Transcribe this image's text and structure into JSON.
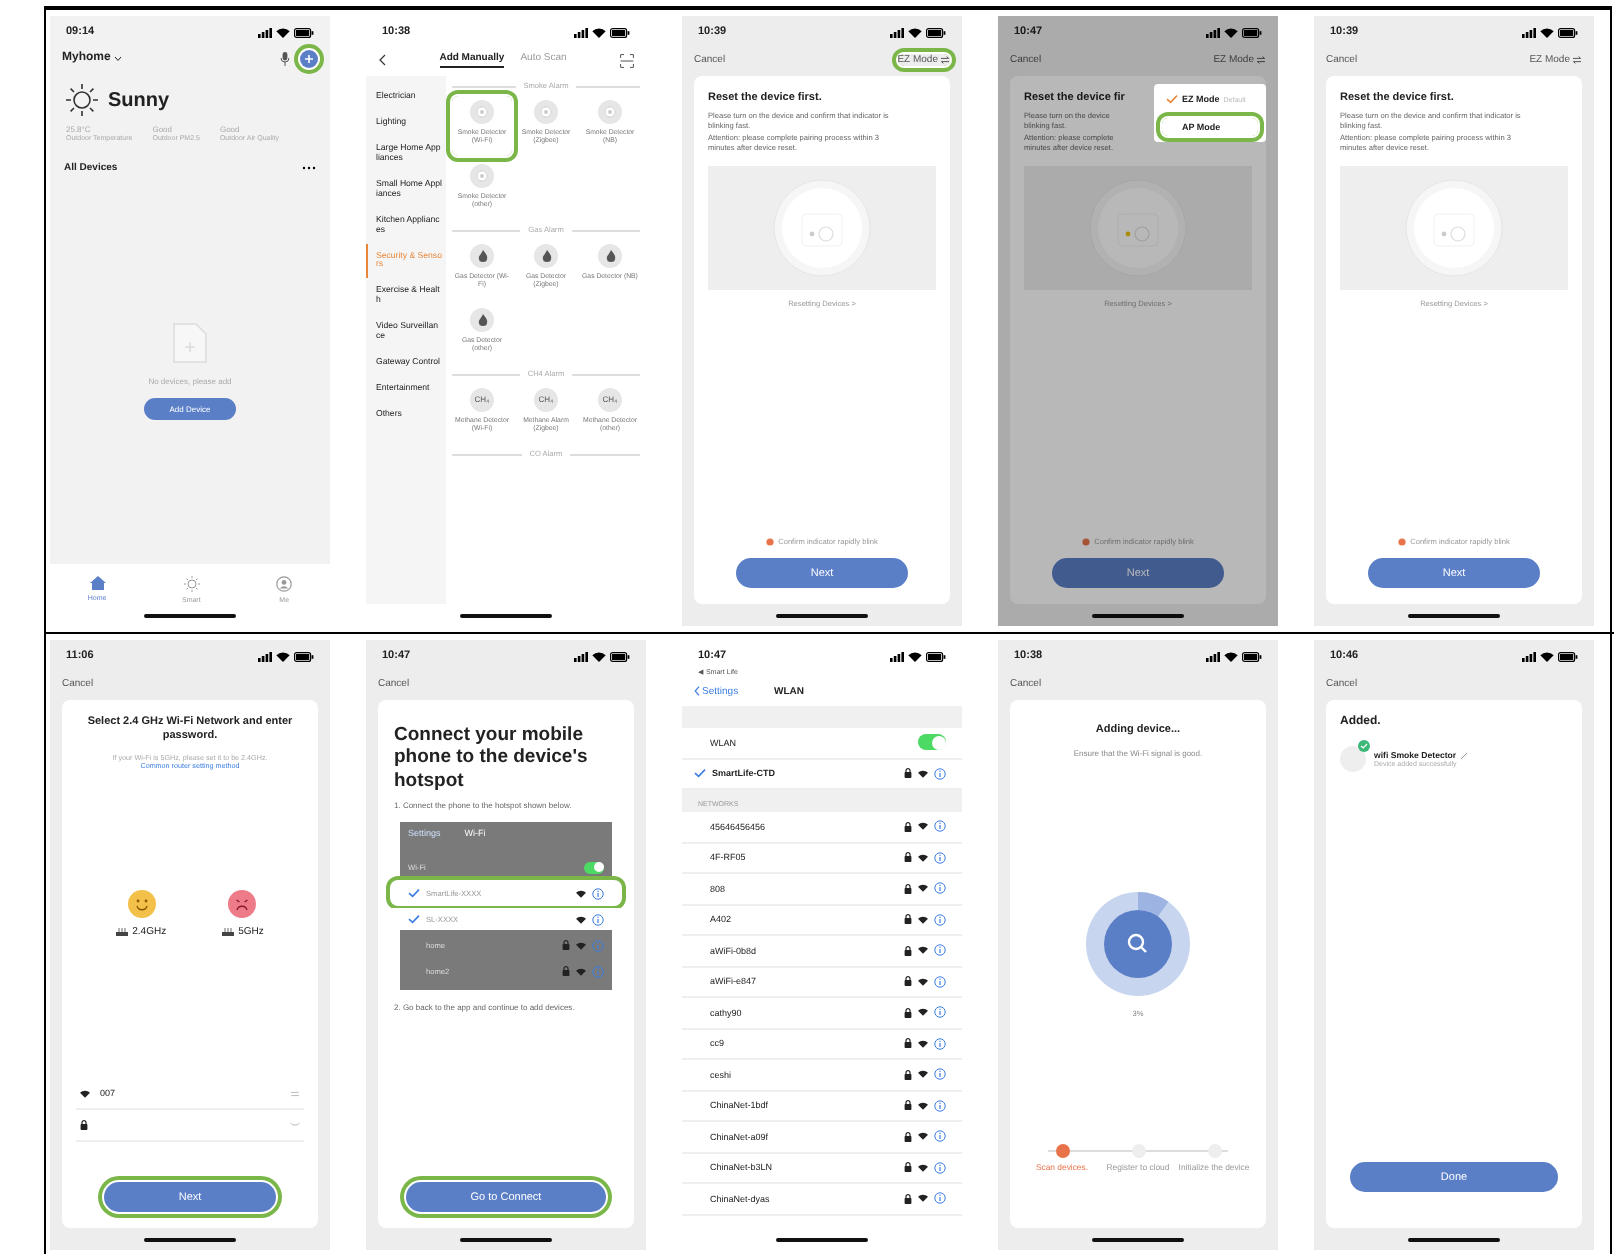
{
  "screens": [
    {
      "kind": "home",
      "time": "09:14",
      "home_name": "Myhome",
      "add_highlighted": true,
      "weather": "Sunny",
      "stats": [
        {
          "value": "25.8°C",
          "label": "Outdoor Temperature"
        },
        {
          "value": "Good",
          "label": "Outdoor PM2.5"
        },
        {
          "value": "Good",
          "label": "Outdoor Air Quality"
        }
      ],
      "section": "All Devices",
      "empty_text": "No devices, please add",
      "add_button": "Add Device",
      "tabs": [
        {
          "label": "Home",
          "selected": true
        },
        {
          "label": "Smart",
          "selected": false
        },
        {
          "label": "Me",
          "selected": false
        }
      ]
    },
    {
      "kind": "catalog",
      "time": "10:38",
      "tabs": [
        {
          "label": "Add Manually",
          "selected": true
        },
        {
          "label": "Auto Scan",
          "selected": false
        }
      ],
      "categories": [
        {
          "label": "Electrician",
          "selected": false
        },
        {
          "label": "Lighting",
          "selected": false
        },
        {
          "label": "Large Home Appliances",
          "selected": false
        },
        {
          "label": "Small Home Appliances",
          "selected": false
        },
        {
          "label": "Kitchen Appliances",
          "selected": false
        },
        {
          "label": "Security & Sensors",
          "selected": true
        },
        {
          "label": "Exercise & Health",
          "selected": false
        },
        {
          "label": "Video Surveillance",
          "selected": false
        },
        {
          "label": "Gateway Control",
          "selected": false
        },
        {
          "label": "Entertainment",
          "selected": false
        },
        {
          "label": "Others",
          "selected": false
        }
      ],
      "groups": [
        {
          "title": "Smoke Alarm",
          "items": [
            {
              "label": "Smoke Detector (Wi-Fi)",
              "highlighted": true
            },
            {
              "label": "Smoke Detector (Zigbee)",
              "highlighted": false
            },
            {
              "label": "Smoke Detector (NB)",
              "highlighted": false
            },
            {
              "label": "Smoke Detector (other)",
              "highlighted": false
            }
          ]
        },
        {
          "title": "Gas Alarm",
          "items": [
            {
              "label": "Gas Detector (Wi-Fi)",
              "highlighted": false
            },
            {
              "label": "Gas Detector (Zigbee)",
              "highlighted": false
            },
            {
              "label": "Gas Detector (NB)",
              "highlighted": false
            },
            {
              "label": "Gas Detector (other)",
              "highlighted": false
            }
          ]
        },
        {
          "title": "CH4 Alarm",
          "items": [
            {
              "label": "Methane Detector (Wi-Fi)",
              "icon_text": "CH₄",
              "highlighted": false
            },
            {
              "label": "Methane Alarm (Zigbee)",
              "icon_text": "CH₄",
              "highlighted": false
            },
            {
              "label": "Methane Detector (other)",
              "icon_text": "CH₄",
              "highlighted": false
            }
          ]
        },
        {
          "title": "CO Alarm"
        }
      ]
    },
    {
      "kind": "reset",
      "time": "10:39",
      "cancel": "Cancel",
      "mode": "EZ Mode",
      "mode_highlighted": true,
      "title": "Reset the device first.",
      "lines": [
        "Please turn on the device and confirm that indicator is",
        "blinking fast.",
        "Attention: please complete pairing process within 3",
        "minutes after device reset."
      ],
      "link": "Resetting Devices >",
      "indicator_lit": false,
      "confirm": "Confirm indicator rapidly blink",
      "button": "Next",
      "dimmed": false
    },
    {
      "kind": "reset",
      "time": "10:47",
      "cancel": "Cancel",
      "mode": "EZ Mode",
      "mode_highlighted": false,
      "title": "Reset the device fir",
      "lines": [
        "Please turn on the device",
        "blinking fast.",
        "Attention: please complete",
        "minutes after device reset."
      ],
      "link": "Resetting Devices >",
      "indicator_lit": true,
      "confirm": "Confirm indicator rapidly blink",
      "button": "Next",
      "dimmed": true,
      "menu": {
        "items": [
          {
            "label": "EZ Mode",
            "tag": "Default",
            "selected": true,
            "highlighted": false
          },
          {
            "label": "AP Mode",
            "selected": false,
            "highlighted": true
          }
        ]
      }
    },
    {
      "kind": "reset",
      "time": "10:39",
      "cancel": "Cancel",
      "mode": "EZ Mode",
      "mode_highlighted": false,
      "title": "Reset the device first.",
      "lines": [
        "Please turn on the device and confirm that indicator is",
        "blinking fast.",
        "Attention: please complete pairing process within 3",
        "minutes after device reset."
      ],
      "link": "Resetting Devices >",
      "indicator_lit": false,
      "confirm": "Confirm indicator rapidly blink",
      "button": "Next",
      "dimmed": false
    },
    {
      "kind": "wifi_select",
      "time": "11:06",
      "cancel": "Cancel",
      "title": "Select 2.4 GHz Wi-Fi Network and enter password.",
      "hint": "If your Wi-Fi is 5GHz, please set it to be 2.4GHz.",
      "link": "Common router setting method",
      "bands": [
        {
          "label": "2.4GHz",
          "ok": true
        },
        {
          "label": "5GHz",
          "ok": false
        }
      ],
      "network": "007",
      "button": "Next",
      "button_highlighted": true
    },
    {
      "kind": "hotspot",
      "time": "10:47",
      "cancel": "Cancel",
      "title": "Connect your mobile phone to the device's hotspot",
      "step1": "1. Connect the phone to the hotspot shown below.",
      "inset": {
        "back": "Settings",
        "title": "Wi-Fi",
        "rows": [
          {
            "kind": "toggle",
            "label": "Wi-Fi",
            "on": true
          },
          {
            "kind": "network",
            "label": "SmartLife-XXXX",
            "checked": true,
            "popped": true,
            "highlighted": true,
            "secured": false
          },
          {
            "kind": "network",
            "label": "SL-XXXX",
            "checked": true,
            "popped": true,
            "highlighted": false,
            "secured": false
          },
          {
            "kind": "network",
            "label": "home",
            "checked": false,
            "popped": false,
            "highlighted": false,
            "secured": true
          },
          {
            "kind": "network",
            "label": "home2",
            "checked": false,
            "popped": false,
            "highlighted": false,
            "secured": true
          }
        ]
      },
      "step2": "2. Go back to the app and continue to add devices.",
      "button": "Go to Connect",
      "button_highlighted": true
    },
    {
      "kind": "wlan",
      "time": "10:47",
      "back_app": "◀ Smart Life",
      "back": "Settings",
      "title": "WLAN",
      "toggle_label": "WLAN",
      "on": true,
      "connected": "SmartLife-CTD",
      "section": "NETWORKS",
      "networks": [
        "45646456456",
        "4F-RF05",
        "808",
        "A402",
        "aWiFi-0b8d",
        "aWiFi-e847",
        "cathy90",
        "cc9",
        "ceshi",
        "ChinaNet-1bdf",
        "ChinaNet-a09f",
        "ChinaNet-b3LN",
        "ChinaNet-dyas"
      ]
    },
    {
      "kind": "adding",
      "time": "10:38",
      "cancel": "Cancel",
      "title": "Adding device...",
      "subtitle": "Ensure that the Wi-Fi signal is good.",
      "level": 0.1,
      "percent": "3%",
      "steps": [
        {
          "label": "Scan devices.",
          "selected": true
        },
        {
          "label": "Register to cloud",
          "selected": false
        },
        {
          "label": "Initialize the device",
          "selected": false
        }
      ]
    },
    {
      "kind": "added",
      "time": "10:46",
      "cancel": "Cancel",
      "title": "Added.",
      "device": "wifi Smoke Detector",
      "status": "Device added successfully",
      "button": "Done"
    }
  ]
}
